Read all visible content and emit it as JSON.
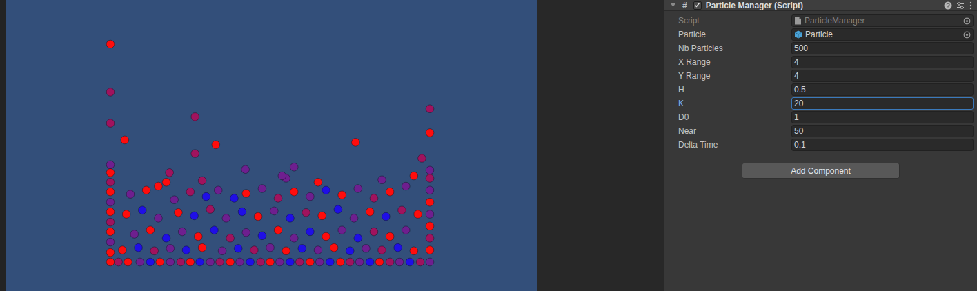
{
  "game_view": {
    "particles": [
      {
        "x": 0,
        "y": 0,
        "color": "#ff0d0d"
      },
      {
        "x": 0.1,
        "y": 0,
        "color": "#a0135e"
      },
      {
        "x": 0.22,
        "y": 0,
        "color": "#ff0d0d"
      },
      {
        "x": 0.37,
        "y": 0,
        "color": "#6e1f8f"
      },
      {
        "x": 0.5,
        "y": 0,
        "color": "#1f0fe6"
      },
      {
        "x": 0.62,
        "y": 0,
        "color": "#ff0d0d"
      },
      {
        "x": 0.75,
        "y": 0,
        "color": "#6e1f8f"
      },
      {
        "x": 0.88,
        "y": 0,
        "color": "#a0135e"
      },
      {
        "x": 1.0,
        "y": 0,
        "color": "#ff0d0d"
      },
      {
        "x": 1.12,
        "y": 0,
        "color": "#1f0fe6"
      },
      {
        "x": 1.25,
        "y": 0,
        "color": "#6e1f8f"
      },
      {
        "x": 1.37,
        "y": 0,
        "color": "#a0135e"
      },
      {
        "x": 1.5,
        "y": 0,
        "color": "#ff0d0d"
      },
      {
        "x": 1.62,
        "y": 0,
        "color": "#6e1f8f"
      },
      {
        "x": 1.75,
        "y": 0,
        "color": "#1f0fe6"
      },
      {
        "x": 1.88,
        "y": 0,
        "color": "#a0135e"
      },
      {
        "x": 2.0,
        "y": 0,
        "color": "#ff0d0d"
      },
      {
        "x": 2.12,
        "y": 0,
        "color": "#6e1f8f"
      },
      {
        "x": 2.25,
        "y": 0,
        "color": "#1f0fe6"
      },
      {
        "x": 2.37,
        "y": 0,
        "color": "#a0135e"
      },
      {
        "x": 2.5,
        "y": 0,
        "color": "#ff0d0d"
      },
      {
        "x": 2.62,
        "y": 0,
        "color": "#6e1f8f"
      },
      {
        "x": 2.75,
        "y": 0,
        "color": "#1f0fe6"
      },
      {
        "x": 2.88,
        "y": 0,
        "color": "#ff0d0d"
      },
      {
        "x": 3.0,
        "y": 0,
        "color": "#a0135e"
      },
      {
        "x": 3.12,
        "y": 0,
        "color": "#6e1f8f"
      },
      {
        "x": 3.25,
        "y": 0,
        "color": "#1f0fe6"
      },
      {
        "x": 3.37,
        "y": 0,
        "color": "#ff0d0d"
      },
      {
        "x": 3.5,
        "y": 0,
        "color": "#a0135e"
      },
      {
        "x": 3.62,
        "y": 0,
        "color": "#6e1f8f"
      },
      {
        "x": 3.75,
        "y": 0,
        "color": "#1f0fe6"
      },
      {
        "x": 3.88,
        "y": 0,
        "color": "#a0135e"
      },
      {
        "x": 4.0,
        "y": 0,
        "color": "#6e1f8f"
      },
      {
        "x": 0,
        "y": 0.12,
        "color": "#ff0d0d"
      },
      {
        "x": 0,
        "y": 0.25,
        "color": "#6e1f8f"
      },
      {
        "x": 0,
        "y": 0.38,
        "color": "#ff0d0d"
      },
      {
        "x": 0,
        "y": 0.5,
        "color": "#a0135e"
      },
      {
        "x": 0,
        "y": 0.63,
        "color": "#ff0d0d"
      },
      {
        "x": 0,
        "y": 0.75,
        "color": "#6e1f8f"
      },
      {
        "x": 0,
        "y": 0.88,
        "color": "#ff0d0d"
      },
      {
        "x": 0,
        "y": 1.0,
        "color": "#a0135e"
      },
      {
        "x": 0,
        "y": 1.12,
        "color": "#ff0d0d"
      },
      {
        "x": 0,
        "y": 1.22,
        "color": "#6e1f8f"
      },
      {
        "x": 4,
        "y": 0.15,
        "color": "#ff0d0d"
      },
      {
        "x": 4,
        "y": 0.3,
        "color": "#a0135e"
      },
      {
        "x": 4,
        "y": 0.45,
        "color": "#ff0d0d"
      },
      {
        "x": 4,
        "y": 0.6,
        "color": "#6e1f8f"
      },
      {
        "x": 4,
        "y": 0.75,
        "color": "#ff0d0d"
      },
      {
        "x": 4,
        "y": 0.9,
        "color": "#6e1f8f"
      },
      {
        "x": 4,
        "y": 1.05,
        "color": "#a0135e"
      },
      {
        "x": 4,
        "y": 1.15,
        "color": "#6e1f8f"
      },
      {
        "x": 0.25,
        "y": 0.85,
        "color": "#6e1f8f"
      },
      {
        "x": 0.45,
        "y": 0.9,
        "color": "#ff0d0d"
      },
      {
        "x": 0.6,
        "y": 0.95,
        "color": "#ff0d0d"
      },
      {
        "x": 0.8,
        "y": 0.78,
        "color": "#6e1f8f"
      },
      {
        "x": 1.0,
        "y": 0.88,
        "color": "#a0135e"
      },
      {
        "x": 1.2,
        "y": 0.82,
        "color": "#1f0fe6"
      },
      {
        "x": 1.35,
        "y": 0.9,
        "color": "#6e1f8f"
      },
      {
        "x": 1.55,
        "y": 0.8,
        "color": "#1f0fe6"
      },
      {
        "x": 1.7,
        "y": 0.86,
        "color": "#ff0d0d"
      },
      {
        "x": 1.9,
        "y": 0.92,
        "color": "#6e1f8f"
      },
      {
        "x": 2.1,
        "y": 0.8,
        "color": "#a0135e"
      },
      {
        "x": 2.3,
        "y": 0.88,
        "color": "#ff0d0d"
      },
      {
        "x": 2.5,
        "y": 0.82,
        "color": "#6e1f8f"
      },
      {
        "x": 2.7,
        "y": 0.9,
        "color": "#1f0fe6"
      },
      {
        "x": 2.9,
        "y": 0.84,
        "color": "#ff0d0d"
      },
      {
        "x": 3.1,
        "y": 0.92,
        "color": "#6e1f8f"
      },
      {
        "x": 3.3,
        "y": 0.8,
        "color": "#a0135e"
      },
      {
        "x": 3.5,
        "y": 0.88,
        "color": "#ff0d0d"
      },
      {
        "x": 3.7,
        "y": 0.95,
        "color": "#6e1f8f"
      },
      {
        "x": 0.2,
        "y": 0.6,
        "color": "#ff0d0d"
      },
      {
        "x": 0.4,
        "y": 0.65,
        "color": "#1f0fe6"
      },
      {
        "x": 0.6,
        "y": 0.55,
        "color": "#6e1f8f"
      },
      {
        "x": 0.85,
        "y": 0.62,
        "color": "#ff0d0d"
      },
      {
        "x": 1.05,
        "y": 0.58,
        "color": "#1f0fe6"
      },
      {
        "x": 1.25,
        "y": 0.66,
        "color": "#a0135e"
      },
      {
        "x": 1.45,
        "y": 0.55,
        "color": "#6e1f8f"
      },
      {
        "x": 1.65,
        "y": 0.63,
        "color": "#1f0fe6"
      },
      {
        "x": 1.85,
        "y": 0.57,
        "color": "#ff0d0d"
      },
      {
        "x": 2.05,
        "y": 0.64,
        "color": "#6e1f8f"
      },
      {
        "x": 2.25,
        "y": 0.55,
        "color": "#1f0fe6"
      },
      {
        "x": 2.45,
        "y": 0.62,
        "color": "#a0135e"
      },
      {
        "x": 2.65,
        "y": 0.58,
        "color": "#ff0d0d"
      },
      {
        "x": 2.85,
        "y": 0.66,
        "color": "#1f0fe6"
      },
      {
        "x": 3.05,
        "y": 0.55,
        "color": "#6e1f8f"
      },
      {
        "x": 3.25,
        "y": 0.63,
        "color": "#ff0d0d"
      },
      {
        "x": 3.45,
        "y": 0.57,
        "color": "#1f0fe6"
      },
      {
        "x": 3.65,
        "y": 0.65,
        "color": "#a0135e"
      },
      {
        "x": 3.85,
        "y": 0.6,
        "color": "#ff0d0d"
      },
      {
        "x": 0.3,
        "y": 0.35,
        "color": "#6e1f8f"
      },
      {
        "x": 0.5,
        "y": 0.4,
        "color": "#ff0d0d"
      },
      {
        "x": 0.7,
        "y": 0.3,
        "color": "#1f0fe6"
      },
      {
        "x": 0.9,
        "y": 0.38,
        "color": "#6e1f8f"
      },
      {
        "x": 1.1,
        "y": 0.32,
        "color": "#ff0d0d"
      },
      {
        "x": 1.3,
        "y": 0.4,
        "color": "#1f0fe6"
      },
      {
        "x": 1.5,
        "y": 0.3,
        "color": "#a0135e"
      },
      {
        "x": 1.7,
        "y": 0.37,
        "color": "#6e1f8f"
      },
      {
        "x": 1.9,
        "y": 0.33,
        "color": "#1f0fe6"
      },
      {
        "x": 2.1,
        "y": 0.4,
        "color": "#ff0d0d"
      },
      {
        "x": 2.3,
        "y": 0.3,
        "color": "#6e1f8f"
      },
      {
        "x": 2.5,
        "y": 0.38,
        "color": "#1f0fe6"
      },
      {
        "x": 2.7,
        "y": 0.32,
        "color": "#ff0d0d"
      },
      {
        "x": 2.9,
        "y": 0.4,
        "color": "#6e1f8f"
      },
      {
        "x": 3.1,
        "y": 0.3,
        "color": "#1f0fe6"
      },
      {
        "x": 3.3,
        "y": 0.38,
        "color": "#a0135e"
      },
      {
        "x": 3.5,
        "y": 0.32,
        "color": "#ff0d0d"
      },
      {
        "x": 3.7,
        "y": 0.4,
        "color": "#6e1f8f"
      },
      {
        "x": 0.15,
        "y": 0.15,
        "color": "#ff0d0d"
      },
      {
        "x": 0.35,
        "y": 0.18,
        "color": "#1f0fe6"
      },
      {
        "x": 0.55,
        "y": 0.14,
        "color": "#a0135e"
      },
      {
        "x": 0.75,
        "y": 0.17,
        "color": "#6e1f8f"
      },
      {
        "x": 0.95,
        "y": 0.15,
        "color": "#1f0fe6"
      },
      {
        "x": 1.15,
        "y": 0.18,
        "color": "#ff0d0d"
      },
      {
        "x": 1.4,
        "y": 0.14,
        "color": "#6e1f8f"
      },
      {
        "x": 1.6,
        "y": 0.17,
        "color": "#1f0fe6"
      },
      {
        "x": 1.8,
        "y": 0.15,
        "color": "#a0135e"
      },
      {
        "x": 2.0,
        "y": 0.18,
        "color": "#6e1f8f"
      },
      {
        "x": 2.2,
        "y": 0.14,
        "color": "#ff0d0d"
      },
      {
        "x": 2.4,
        "y": 0.17,
        "color": "#1f0fe6"
      },
      {
        "x": 2.6,
        "y": 0.15,
        "color": "#6e1f8f"
      },
      {
        "x": 2.8,
        "y": 0.18,
        "color": "#ff0d0d"
      },
      {
        "x": 3.0,
        "y": 0.14,
        "color": "#1f0fe6"
      },
      {
        "x": 3.2,
        "y": 0.17,
        "color": "#6e1f8f"
      },
      {
        "x": 3.4,
        "y": 0.15,
        "color": "#a0135e"
      },
      {
        "x": 3.6,
        "y": 0.18,
        "color": "#1f0fe6"
      },
      {
        "x": 3.8,
        "y": 0.14,
        "color": "#ff0d0d"
      },
      {
        "x": 0.7,
        "y": 1.0,
        "color": "#ff0d0d"
      },
      {
        "x": 1.15,
        "y": 1.02,
        "color": "#a0135e"
      },
      {
        "x": 2.2,
        "y": 1.05,
        "color": "#6e1f8f"
      },
      {
        "x": 2.6,
        "y": 1.0,
        "color": "#ff0d0d"
      },
      {
        "x": 3.4,
        "y": 1.03,
        "color": "#6e1f8f"
      },
      {
        "x": 3.8,
        "y": 1.08,
        "color": "#ff0d0d"
      },
      {
        "x": 0,
        "y": 2.73,
        "color": "#ff0d0d"
      },
      {
        "x": 0,
        "y": 2.13,
        "color": "#a0135e"
      },
      {
        "x": 0,
        "y": 1.74,
        "color": "#a0135e"
      },
      {
        "x": 0.18,
        "y": 1.53,
        "color": "#ff0d0d"
      },
      {
        "x": 1.06,
        "y": 1.82,
        "color": "#a0135e"
      },
      {
        "x": 1.06,
        "y": 1.36,
        "color": "#a0135e"
      },
      {
        "x": 1.32,
        "y": 1.47,
        "color": "#ff0d0d"
      },
      {
        "x": 3.07,
        "y": 1.5,
        "color": "#ff0d0d"
      },
      {
        "x": 4,
        "y": 1.92,
        "color": "#a0135e"
      },
      {
        "x": 4,
        "y": 1.62,
        "color": "#ff0d0d"
      },
      {
        "x": 3.9,
        "y": 1.3,
        "color": "#a0135e"
      },
      {
        "x": 0.74,
        "y": 1.12,
        "color": "#a0135e"
      },
      {
        "x": 1.69,
        "y": 1.16,
        "color": "#6e1f8f"
      },
      {
        "x": 2.3,
        "y": 1.19,
        "color": "#6e1f8f"
      },
      {
        "x": 2.15,
        "y": 1.08,
        "color": "#6e1f8f"
      }
    ]
  },
  "component": {
    "title": "Particle Manager (Script)",
    "script_icon": "#",
    "enabled": true,
    "expanded": true,
    "fields": [
      {
        "label": "Script",
        "value": "ParticleManager",
        "kind": "script",
        "disabled": true,
        "focused": false
      },
      {
        "label": "Particle",
        "value": "Particle",
        "kind": "prefab",
        "disabled": false,
        "focused": false
      },
      {
        "label": "Nb Particles",
        "value": "500",
        "kind": "number",
        "disabled": false,
        "focused": false
      },
      {
        "label": "X Range",
        "value": "4",
        "kind": "number",
        "disabled": false,
        "focused": false
      },
      {
        "label": "Y Range",
        "value": "4",
        "kind": "number",
        "disabled": false,
        "focused": false
      },
      {
        "label": "H",
        "value": "0.5",
        "kind": "number",
        "disabled": false,
        "focused": false
      },
      {
        "label": "K",
        "value": "20",
        "kind": "number",
        "disabled": false,
        "focused": true
      },
      {
        "label": "D0",
        "value": "1",
        "kind": "number",
        "disabled": false,
        "focused": false
      },
      {
        "label": "Near",
        "value": "50",
        "kind": "number",
        "disabled": false,
        "focused": false
      },
      {
        "label": "Delta Time",
        "value": "0.1",
        "kind": "number",
        "disabled": false,
        "focused": false
      }
    ]
  },
  "button": "Add Component"
}
